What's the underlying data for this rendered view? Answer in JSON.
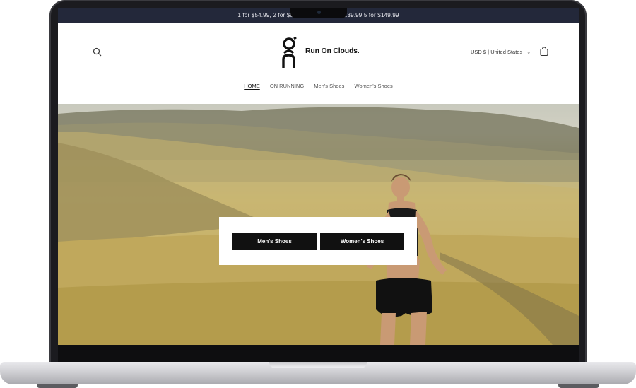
{
  "announcement": {
    "left_text": "1 for $54.99, 2 for $89.",
    "right_text": "$139.99,5 for $149.99"
  },
  "header": {
    "logo_text": "Run On Clouds.",
    "currency_label": "USD $ | United States"
  },
  "nav": {
    "items": [
      "HOME",
      "ON RUNNING",
      "Men's Shoes",
      "Women's Shoes"
    ],
    "active_index": 0
  },
  "hero": {
    "buttons": {
      "men": "Men's Shoes",
      "women": "Women's Shoes"
    }
  },
  "icons": {
    "search": "search-icon",
    "cart": "cart-icon",
    "chevron": "chevron-down-icon",
    "logo": "on-logo-icon"
  },
  "colors": {
    "announcement_bg": "#23283a",
    "button_bg": "#111111",
    "text": "#111111"
  }
}
